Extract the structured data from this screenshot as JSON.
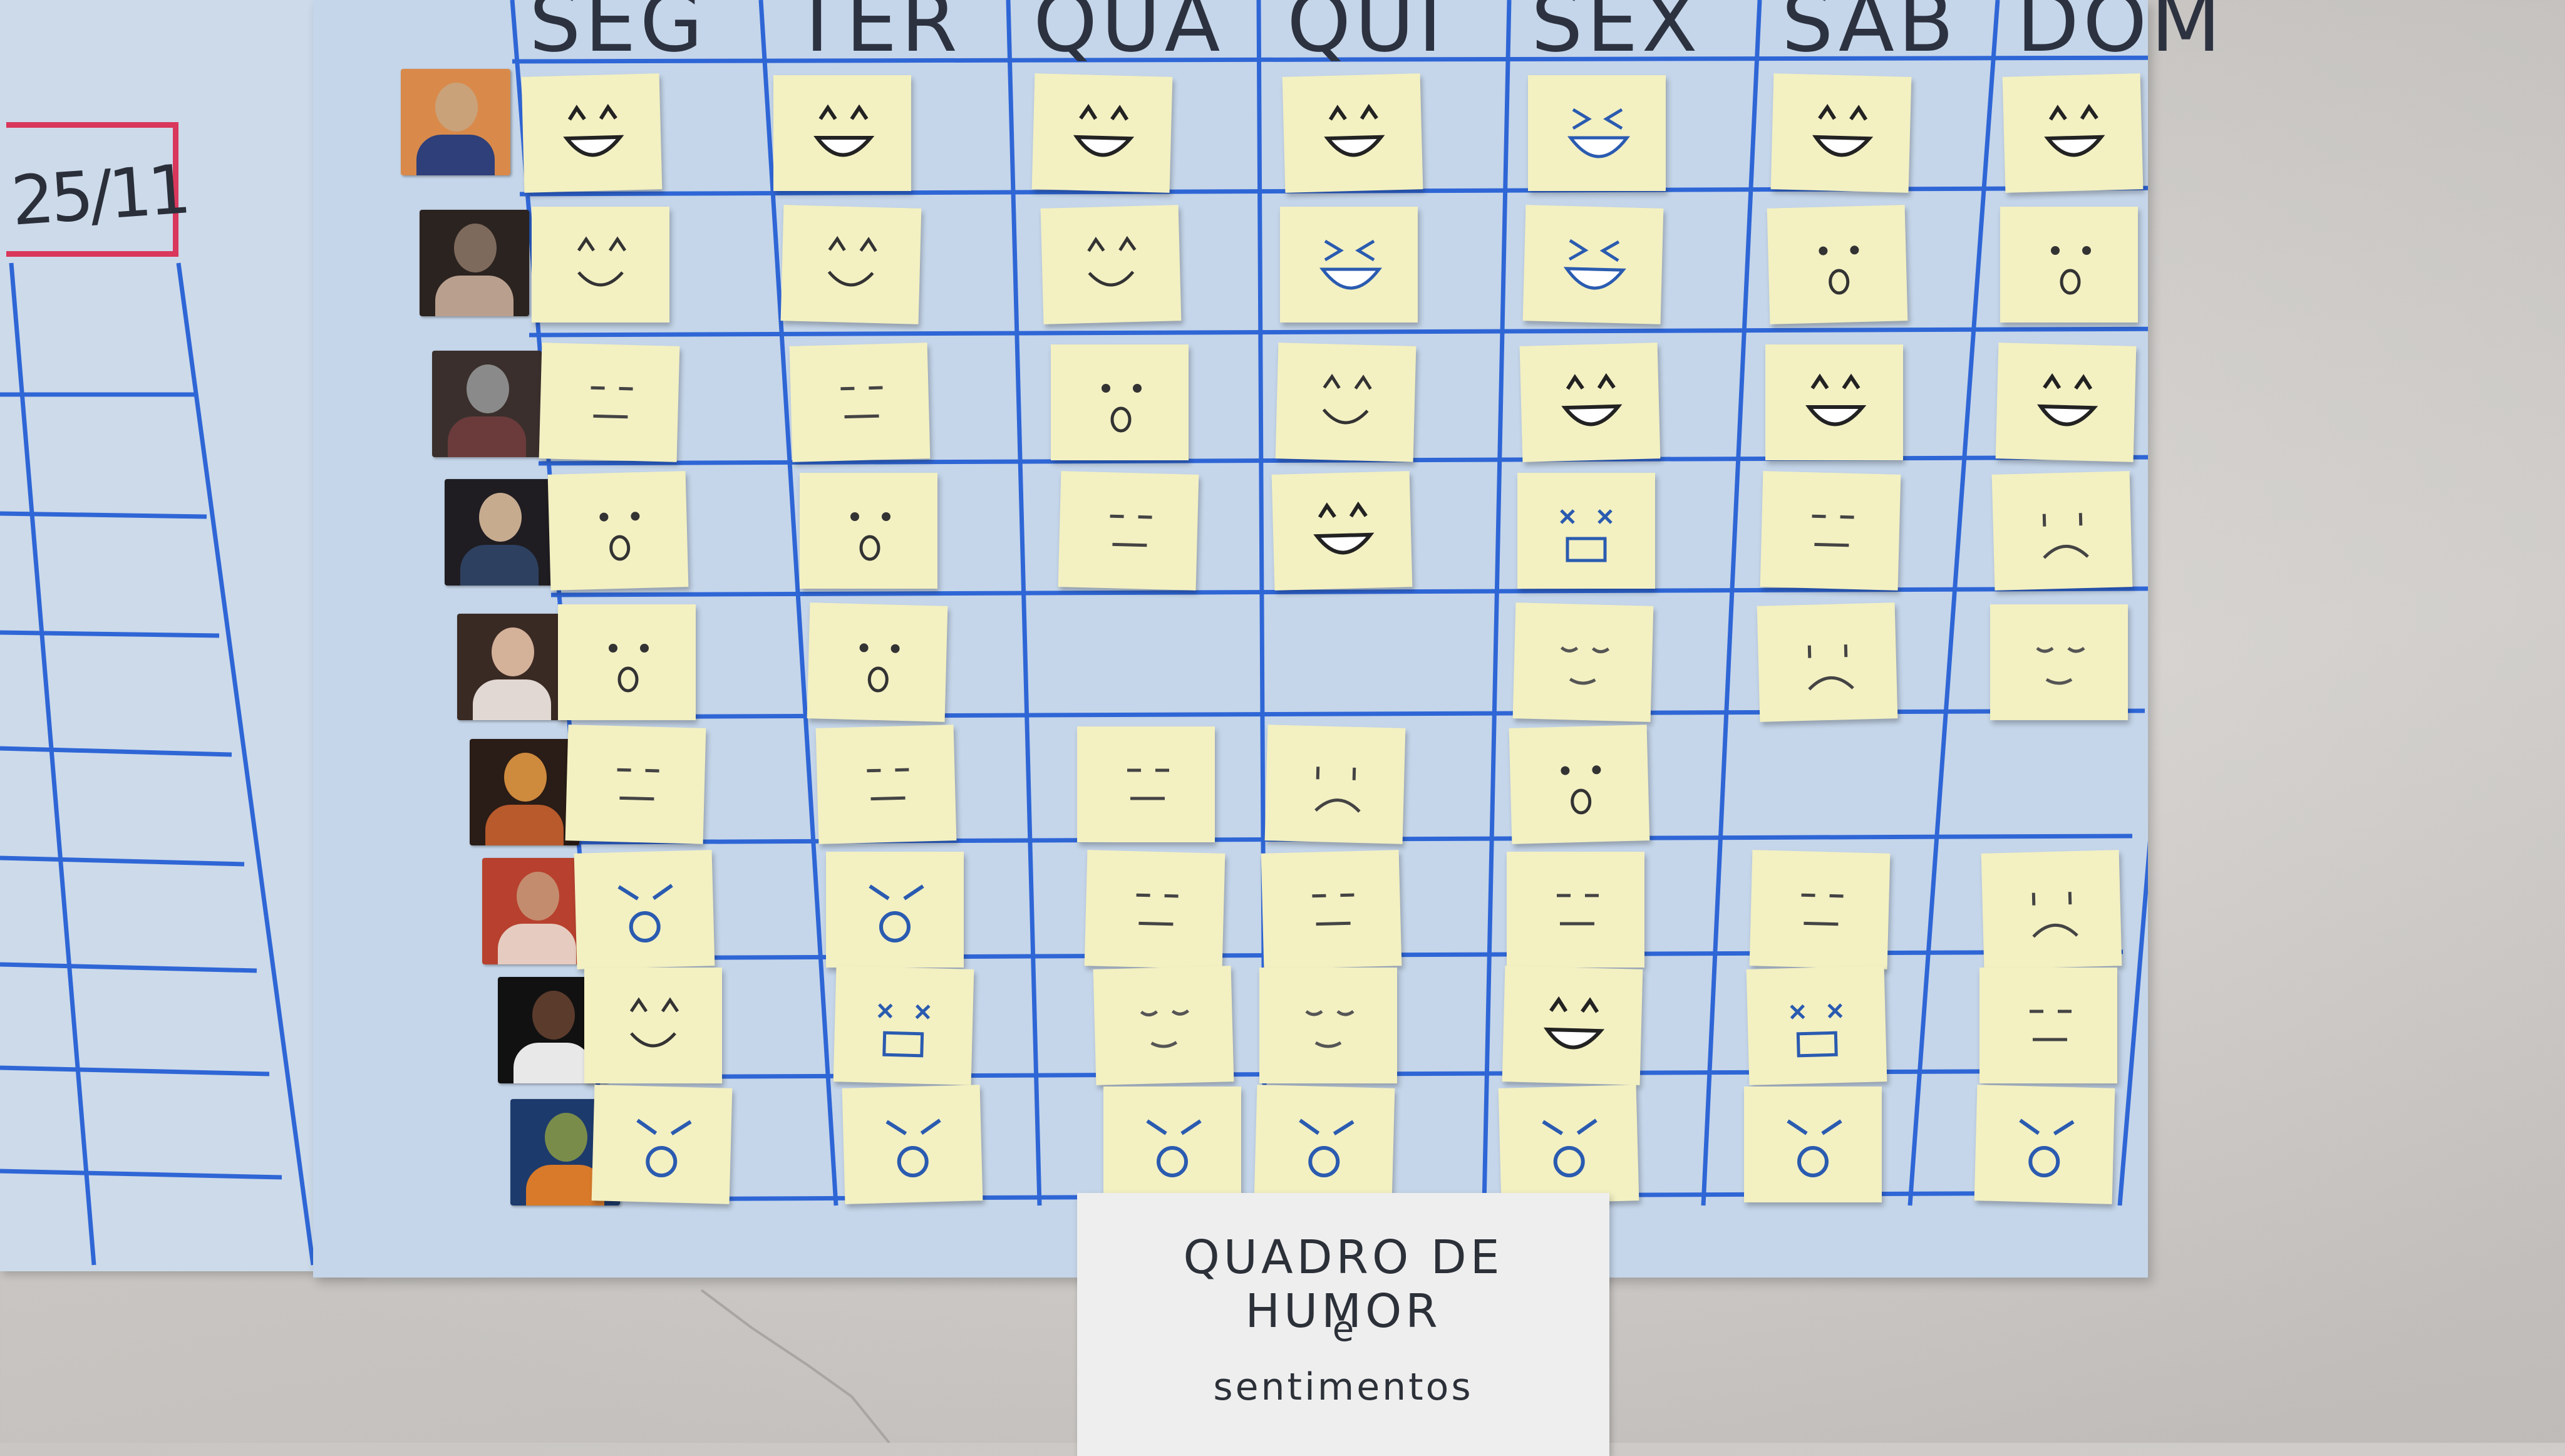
{
  "left_board": {
    "date_label": "25/11"
  },
  "days": [
    "SEG",
    "TER",
    "QUA",
    "QUI",
    "SEX",
    "SAB",
    "DOM"
  ],
  "people": [
    {
      "photo_colors": [
        "#d98a4a",
        "#2e3f7a",
        "#c9a27a"
      ]
    },
    {
      "photo_colors": [
        "#2b2320",
        "#b9a08e",
        "#7d6a5c"
      ]
    },
    {
      "photo_colors": [
        "#3a2f2c",
        "#6b3b3b",
        "#8a8a8a"
      ]
    },
    {
      "photo_colors": [
        "#1f1d22",
        "#2d4060",
        "#c7ab8f"
      ]
    },
    {
      "photo_colors": [
        "#3a2a24",
        "#e2d8d3",
        "#d4b199"
      ]
    },
    {
      "photo_colors": [
        "#2a1c16",
        "#b85a2c",
        "#ce8a3d"
      ]
    },
    {
      "photo_colors": [
        "#b7412e",
        "#e6ccc0",
        "#c48c6f"
      ]
    },
    {
      "photo_colors": [
        "#111111",
        "#e8e8e8",
        "#5b3b2c"
      ]
    },
    {
      "photo_colors": [
        "#1d3a6c",
        "#d87a2a",
        "#7a8c4a"
      ]
    }
  ],
  "title_sheet": {
    "line1": "QUADRO DE HUMOR",
    "line2": "e",
    "line3": "sentimentos"
  },
  "colors": {
    "board": "#c5d6ea",
    "grid_line": "#2f66d6",
    "sticky": "#f3f0c2",
    "date_frame": "#d9375b"
  }
}
